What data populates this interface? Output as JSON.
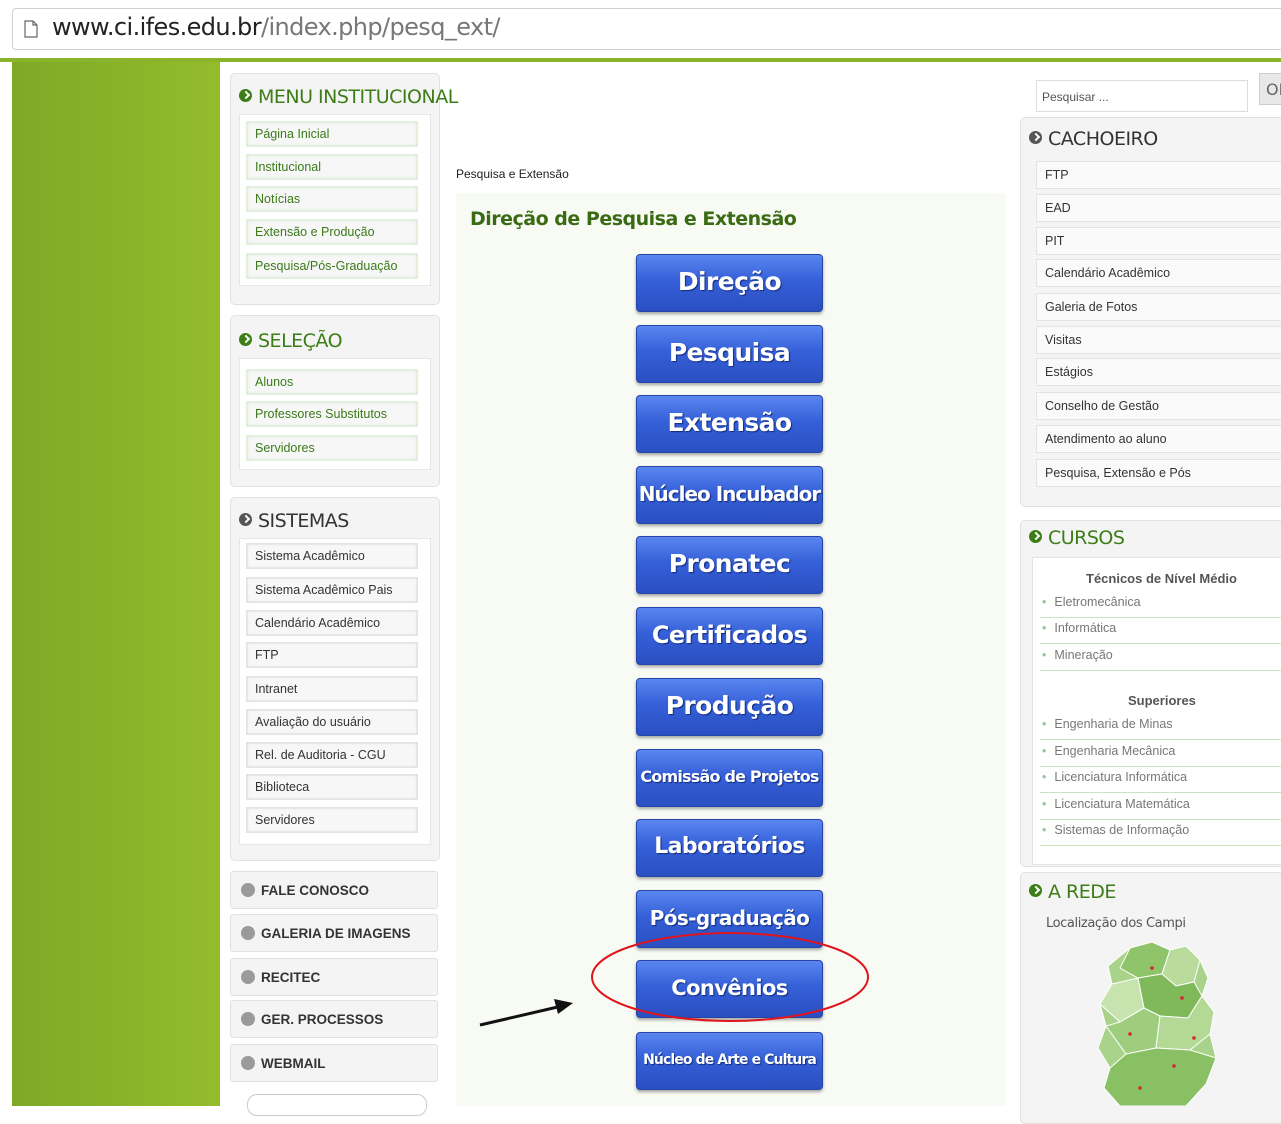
{
  "browser": {
    "url_host": "www.ci.ifes.edu.br",
    "url_path": "/index.php/pesq_ext/"
  },
  "menu_institucional": {
    "title": "MENU INSTITUCIONAL",
    "items": [
      "Página Inicial",
      "Institucional",
      "Notícias",
      "Extensão e Produção",
      "Pesquisa/Pós-Graduação"
    ]
  },
  "selecao": {
    "title": "SELEÇÃO",
    "items": [
      "Alunos",
      "Professores Substitutos",
      "Servidores"
    ]
  },
  "sistemas": {
    "title": "SISTEMAS",
    "items": [
      "Sistema Acadêmico",
      "Sistema Acadêmico Pais",
      "Calendário Acadêmico",
      "FTP",
      "Intranet",
      "Avaliação do usuário",
      "Rel. de Auditoria - CGU",
      "Biblioteca",
      "Servidores"
    ]
  },
  "quick_links": [
    "FALE CONOSCO",
    "GALERIA DE IMAGENS",
    "RECITEC",
    "GER. PROCESSOS",
    "WEBMAIL"
  ],
  "breadcrumb": "Pesquisa e Extensão",
  "main": {
    "title": "Direção de Pesquisa e Extensão",
    "buttons": [
      "Direção",
      "Pesquisa",
      "Extensão",
      "Núcleo Incubador",
      "Pronatec",
      "Certificados",
      "Produção",
      "Comissão de Projetos",
      "Laboratórios",
      "Pós-graduação",
      "Convênios",
      "Núcleo de Arte e Cultura"
    ]
  },
  "search": {
    "placeholder": "Pesquisar ...",
    "button": "OK"
  },
  "cachoeiro": {
    "title": "CACHOEIRO",
    "items": [
      "FTP",
      "EAD",
      "PIT",
      "Calendário Acadêmico",
      "Galeria de Fotos",
      "Visitas",
      "Estágios",
      "Conselho de Gestão",
      "Atendimento ao aluno",
      "Pesquisa, Extensão e Pós"
    ]
  },
  "cursos": {
    "title": "CURSOS",
    "tecnicos_title": "Técnicos de Nível Médio",
    "tecnicos": [
      "Eletromecânica",
      "Informática",
      "Mineração"
    ],
    "superiores_title": "Superiores",
    "superiores": [
      "Engenharia de Minas",
      "Engenharia Mecânica",
      "Licenciatura Informática",
      "Licenciatura Matemática",
      "Sistemas de Informação"
    ]
  },
  "rede": {
    "title": "A REDE",
    "subtitle": "Localização dos Campi"
  },
  "colors": {
    "green": "#3d7d17",
    "sidebar_green": "#8bb32a",
    "button_blue": "#3660d8",
    "annotation_red": "#e0141c"
  }
}
